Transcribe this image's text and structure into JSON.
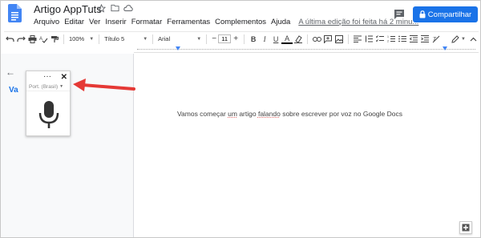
{
  "doc": {
    "title": "Artigo AppTuts",
    "last_edit": "A última edição foi feita há 2 minu...",
    "share_label": "Compartilhar",
    "body_before": "Vamos começar ",
    "body_underlined_1": "um",
    "body_middle": " artigo ",
    "body_underlined_2": "falando",
    "body_after": " sobre escrever por voz no Google Docs"
  },
  "menus": [
    "Arquivo",
    "Editar",
    "Ver",
    "Inserir",
    "Formatar",
    "Ferramentas",
    "Complementos",
    "Ajuda"
  ],
  "toolbar": {
    "zoom": "100%",
    "style": "Título 5",
    "font": "Arial",
    "font_size": "11"
  },
  "outline": {
    "heading_fragment": "Va"
  },
  "voice": {
    "language": "Port. (Brasil)"
  },
  "colors": {
    "accent": "#1a73e8",
    "arrow": "#e53935"
  }
}
